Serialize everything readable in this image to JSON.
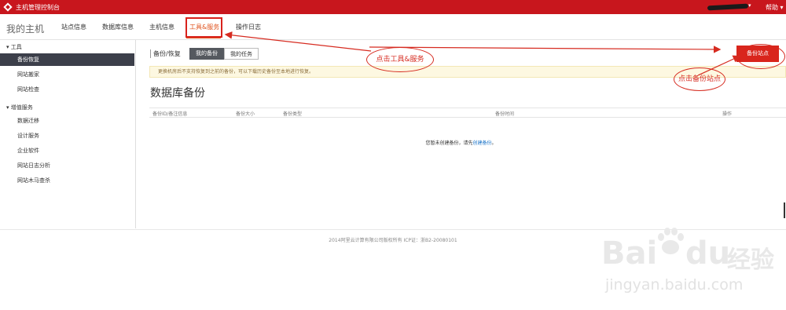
{
  "topbar": {
    "title": "主机管理控制台",
    "help": "帮助"
  },
  "navbar": {
    "brand": "我的主机",
    "tabs": [
      {
        "label": "站点信息"
      },
      {
        "label": "数据库信息"
      },
      {
        "label": "主机信息"
      },
      {
        "label": "工具&服务",
        "active": true
      },
      {
        "label": "操作日志"
      }
    ]
  },
  "sidebar": {
    "group1": "工具",
    "group1_items": [
      "备份恢复",
      "网站搬家",
      "网站检查"
    ],
    "group2": "增值服务",
    "group2_items": [
      "数据迁移",
      "设计服务",
      "企业软件",
      "网站日志分析",
      "网站木马查杀"
    ]
  },
  "content": {
    "crumb": "备份/恢复",
    "tab_my_backup": "我的备份",
    "tab_my_tasks": "我的任务",
    "notice": "更换机房后不支持恢复到之前的备份，可以下载历史备份至本地进行恢复。",
    "heading": "数据库备份",
    "columns": [
      "备份ID/备注信息",
      "备份大小",
      "备份类型",
      "备份时间",
      "操作"
    ],
    "empty_text": "您暂未创建备份，请先",
    "empty_link": "创建备份",
    "empty_end": "。",
    "backup_button": "备份站点"
  },
  "annotations": {
    "callout1": "点击工具&服务",
    "callout2": "点击备份站点"
  },
  "footer": {
    "copyright": "2014阿里云计算有限公司版权所有 ICP证：浙B2-20080101"
  },
  "watermark": {
    "line1": "Bai",
    "line2": "du",
    "line3": "经验",
    "line4": "jingyan.baidu.com"
  },
  "colors": {
    "brand_red": "#c8161d",
    "accent": "#e0531e",
    "button_red": "#d9251c",
    "sidebar_active": "#3c3f4a"
  }
}
